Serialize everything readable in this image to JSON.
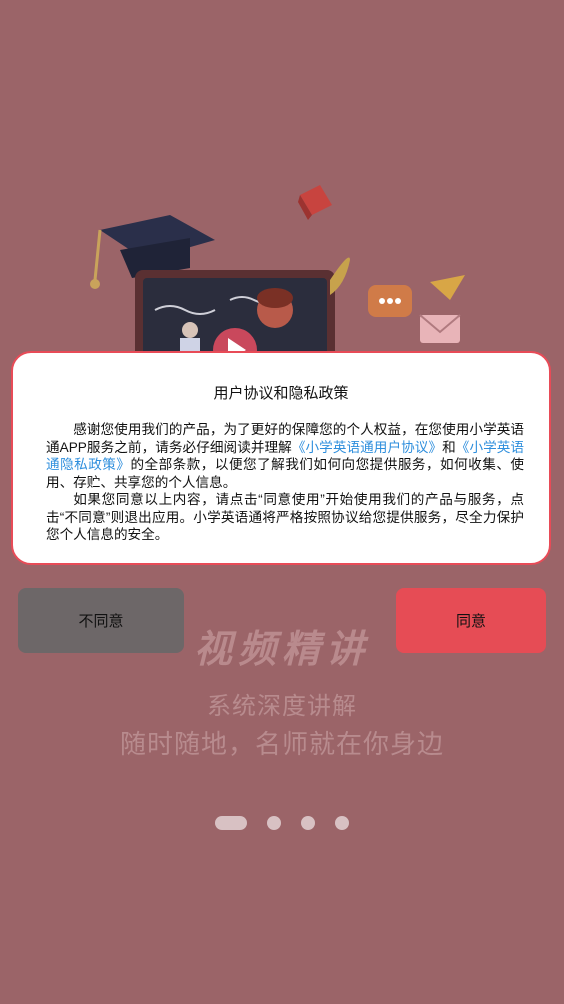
{
  "colors": {
    "overlay_background": "#9b6468",
    "dialog_border": "#e84b57",
    "link": "#2f8fdd",
    "disagree_button": "#6d6768",
    "agree_button": "#e64c55"
  },
  "background": {
    "feature_title": "视频精讲",
    "feature_line1": "系统深度讲解",
    "feature_line2": "随时随地，名师就在你身边",
    "pager": {
      "total": 4,
      "active_index": 0
    }
  },
  "dialog": {
    "title": "用户协议和隐私政策",
    "para1_text1": "感谢您使用我们的产品，为了更好的保障您的个人权益，在您使用小学英语通APP服务之前，请务必仔细阅读并理解",
    "para1_link1": "《小学英语通用户协议》",
    "para1_text2": "和",
    "para1_link2": "《小学英语通隐私政策》",
    "para1_text3": "的全部条款，以便您了解我们如何向您提供服务，如何收集、使用、存贮、共享您的个人信息。",
    "para2": "如果您同意以上内容，请点击“同意使用”开始使用我们的产品与服务，点击“不同意”则退出应用。小学英语通将严格按照协议给您提供服务，尽全力保护您个人信息的安全。"
  },
  "buttons": {
    "disagree_label": "不同意",
    "agree_label": "同意"
  }
}
